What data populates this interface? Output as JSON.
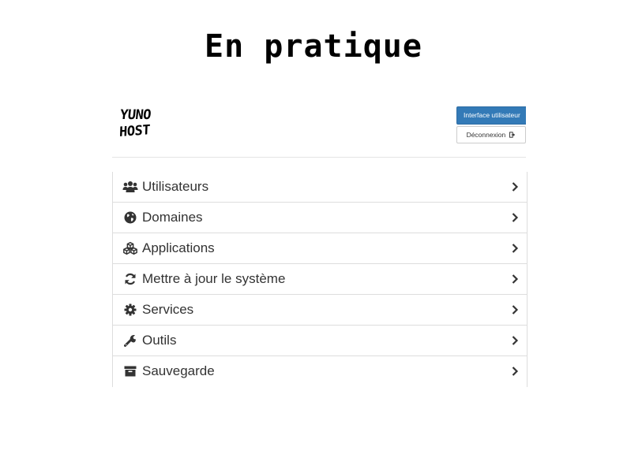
{
  "slide": {
    "title": "En pratique"
  },
  "header": {
    "logo_line1": "YUNO",
    "logo_line2": "HOST",
    "user_button_label": "Interface utilisateur",
    "logout_button_label": "Déconnexion"
  },
  "menu": {
    "items": [
      {
        "label": "Utilisateurs",
        "icon": "users-icon"
      },
      {
        "label": "Domaines",
        "icon": "globe-icon"
      },
      {
        "label": "Applications",
        "icon": "cubes-icon"
      },
      {
        "label": "Mettre à jour le système",
        "icon": "refresh-icon"
      },
      {
        "label": "Services",
        "icon": "gear-icon"
      },
      {
        "label": "Outils",
        "icon": "wrench-icon"
      },
      {
        "label": "Sauvegarde",
        "icon": "archive-icon"
      }
    ]
  },
  "colors": {
    "primary": "#337ab7",
    "text": "#333333",
    "border": "#dddddd"
  }
}
